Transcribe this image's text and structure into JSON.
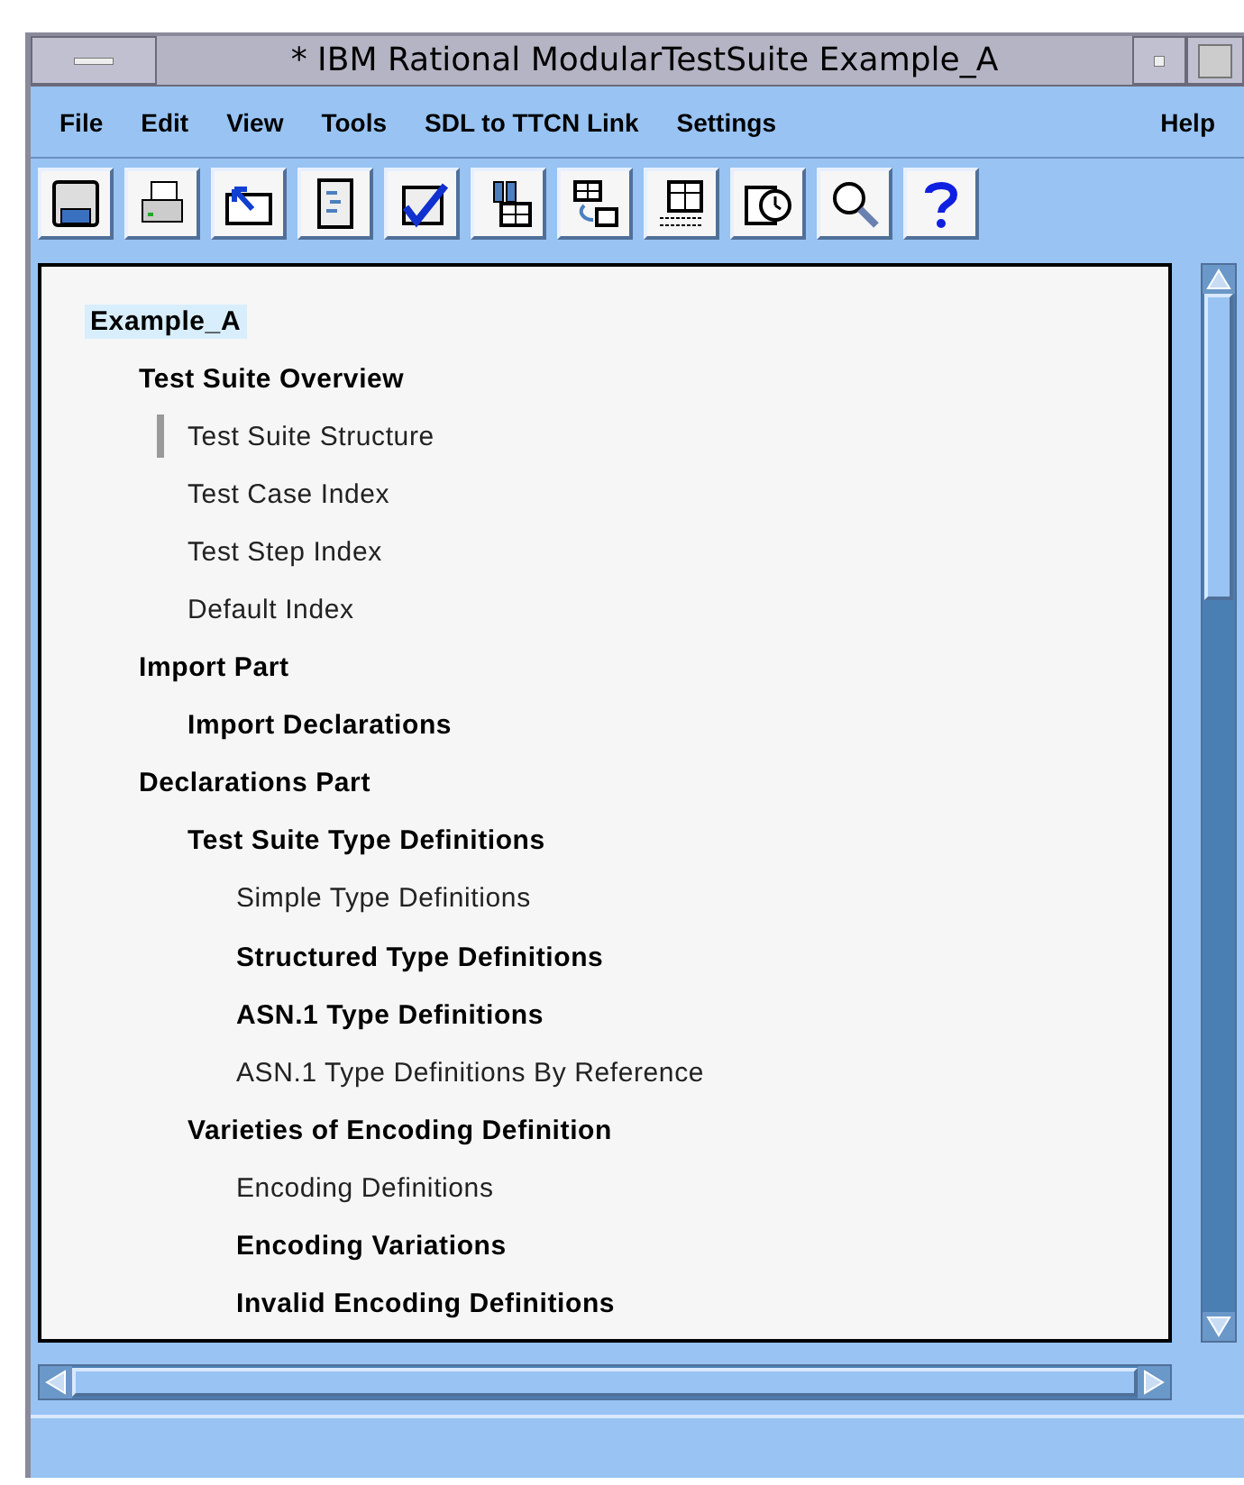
{
  "window": {
    "title": "* IBM Rational ModularTestSuite Example_A"
  },
  "menu": [
    {
      "label": "File"
    },
    {
      "label": "Edit"
    },
    {
      "label": "View"
    },
    {
      "label": "Tools"
    },
    {
      "label": "SDL to TTCN Link"
    },
    {
      "label": "Settings"
    },
    {
      "label": "Help"
    }
  ],
  "toolbar": [
    {
      "kind": "save"
    },
    {
      "kind": "print"
    },
    {
      "kind": "back"
    },
    {
      "kind": "document"
    },
    {
      "kind": "check"
    },
    {
      "kind": "binoculars"
    },
    {
      "kind": "convert"
    },
    {
      "kind": "encode"
    },
    {
      "kind": "timer"
    },
    {
      "kind": "search"
    },
    {
      "kind": "help"
    }
  ],
  "tree": [
    {
      "label": "Example_A",
      "bold": true,
      "selected": true,
      "marked": false,
      "children": [
        {
          "label": "Test Suite Overview",
          "bold": true,
          "selected": false,
          "marked": false,
          "children": [
            {
              "label": "Test Suite Structure",
              "bold": false,
              "selected": false,
              "marked": true
            },
            {
              "label": "Test Case Index",
              "bold": false,
              "selected": false,
              "marked": false
            },
            {
              "label": "Test Step Index",
              "bold": false,
              "selected": false,
              "marked": false
            },
            {
              "label": "Default Index",
              "bold": false,
              "selected": false,
              "marked": false
            }
          ]
        },
        {
          "label": "Import Part",
          "bold": true,
          "selected": false,
          "marked": false,
          "children": [
            {
              "label": "Import Declarations",
              "bold": true,
              "selected": false,
              "marked": false
            }
          ]
        },
        {
          "label": "Declarations Part",
          "bold": true,
          "selected": false,
          "marked": false,
          "children": [
            {
              "label": "Test Suite Type Definitions",
              "bold": true,
              "selected": false,
              "marked": false,
              "children": [
                {
                  "label": "Simple Type Definitions",
                  "bold": false,
                  "selected": false,
                  "marked": false
                },
                {
                  "label": "Structured Type Definitions",
                  "bold": true,
                  "selected": false,
                  "marked": false
                },
                {
                  "label": "ASN.1 Type Definitions",
                  "bold": true,
                  "selected": false,
                  "marked": false
                },
                {
                  "label": "ASN.1 Type Definitions By Reference",
                  "bold": false,
                  "selected": false,
                  "marked": false
                }
              ]
            },
            {
              "label": "Varieties of Encoding Definition",
              "bold": true,
              "selected": false,
              "marked": false,
              "children": [
                {
                  "label": "Encoding Definitions",
                  "bold": false,
                  "selected": false,
                  "marked": false
                },
                {
                  "label": "Encoding Variations",
                  "bold": true,
                  "selected": false,
                  "marked": false
                },
                {
                  "label": "Invalid Encoding Definitions",
                  "bold": true,
                  "selected": false,
                  "marked": false
                }
              ]
            }
          ]
        }
      ]
    }
  ]
}
